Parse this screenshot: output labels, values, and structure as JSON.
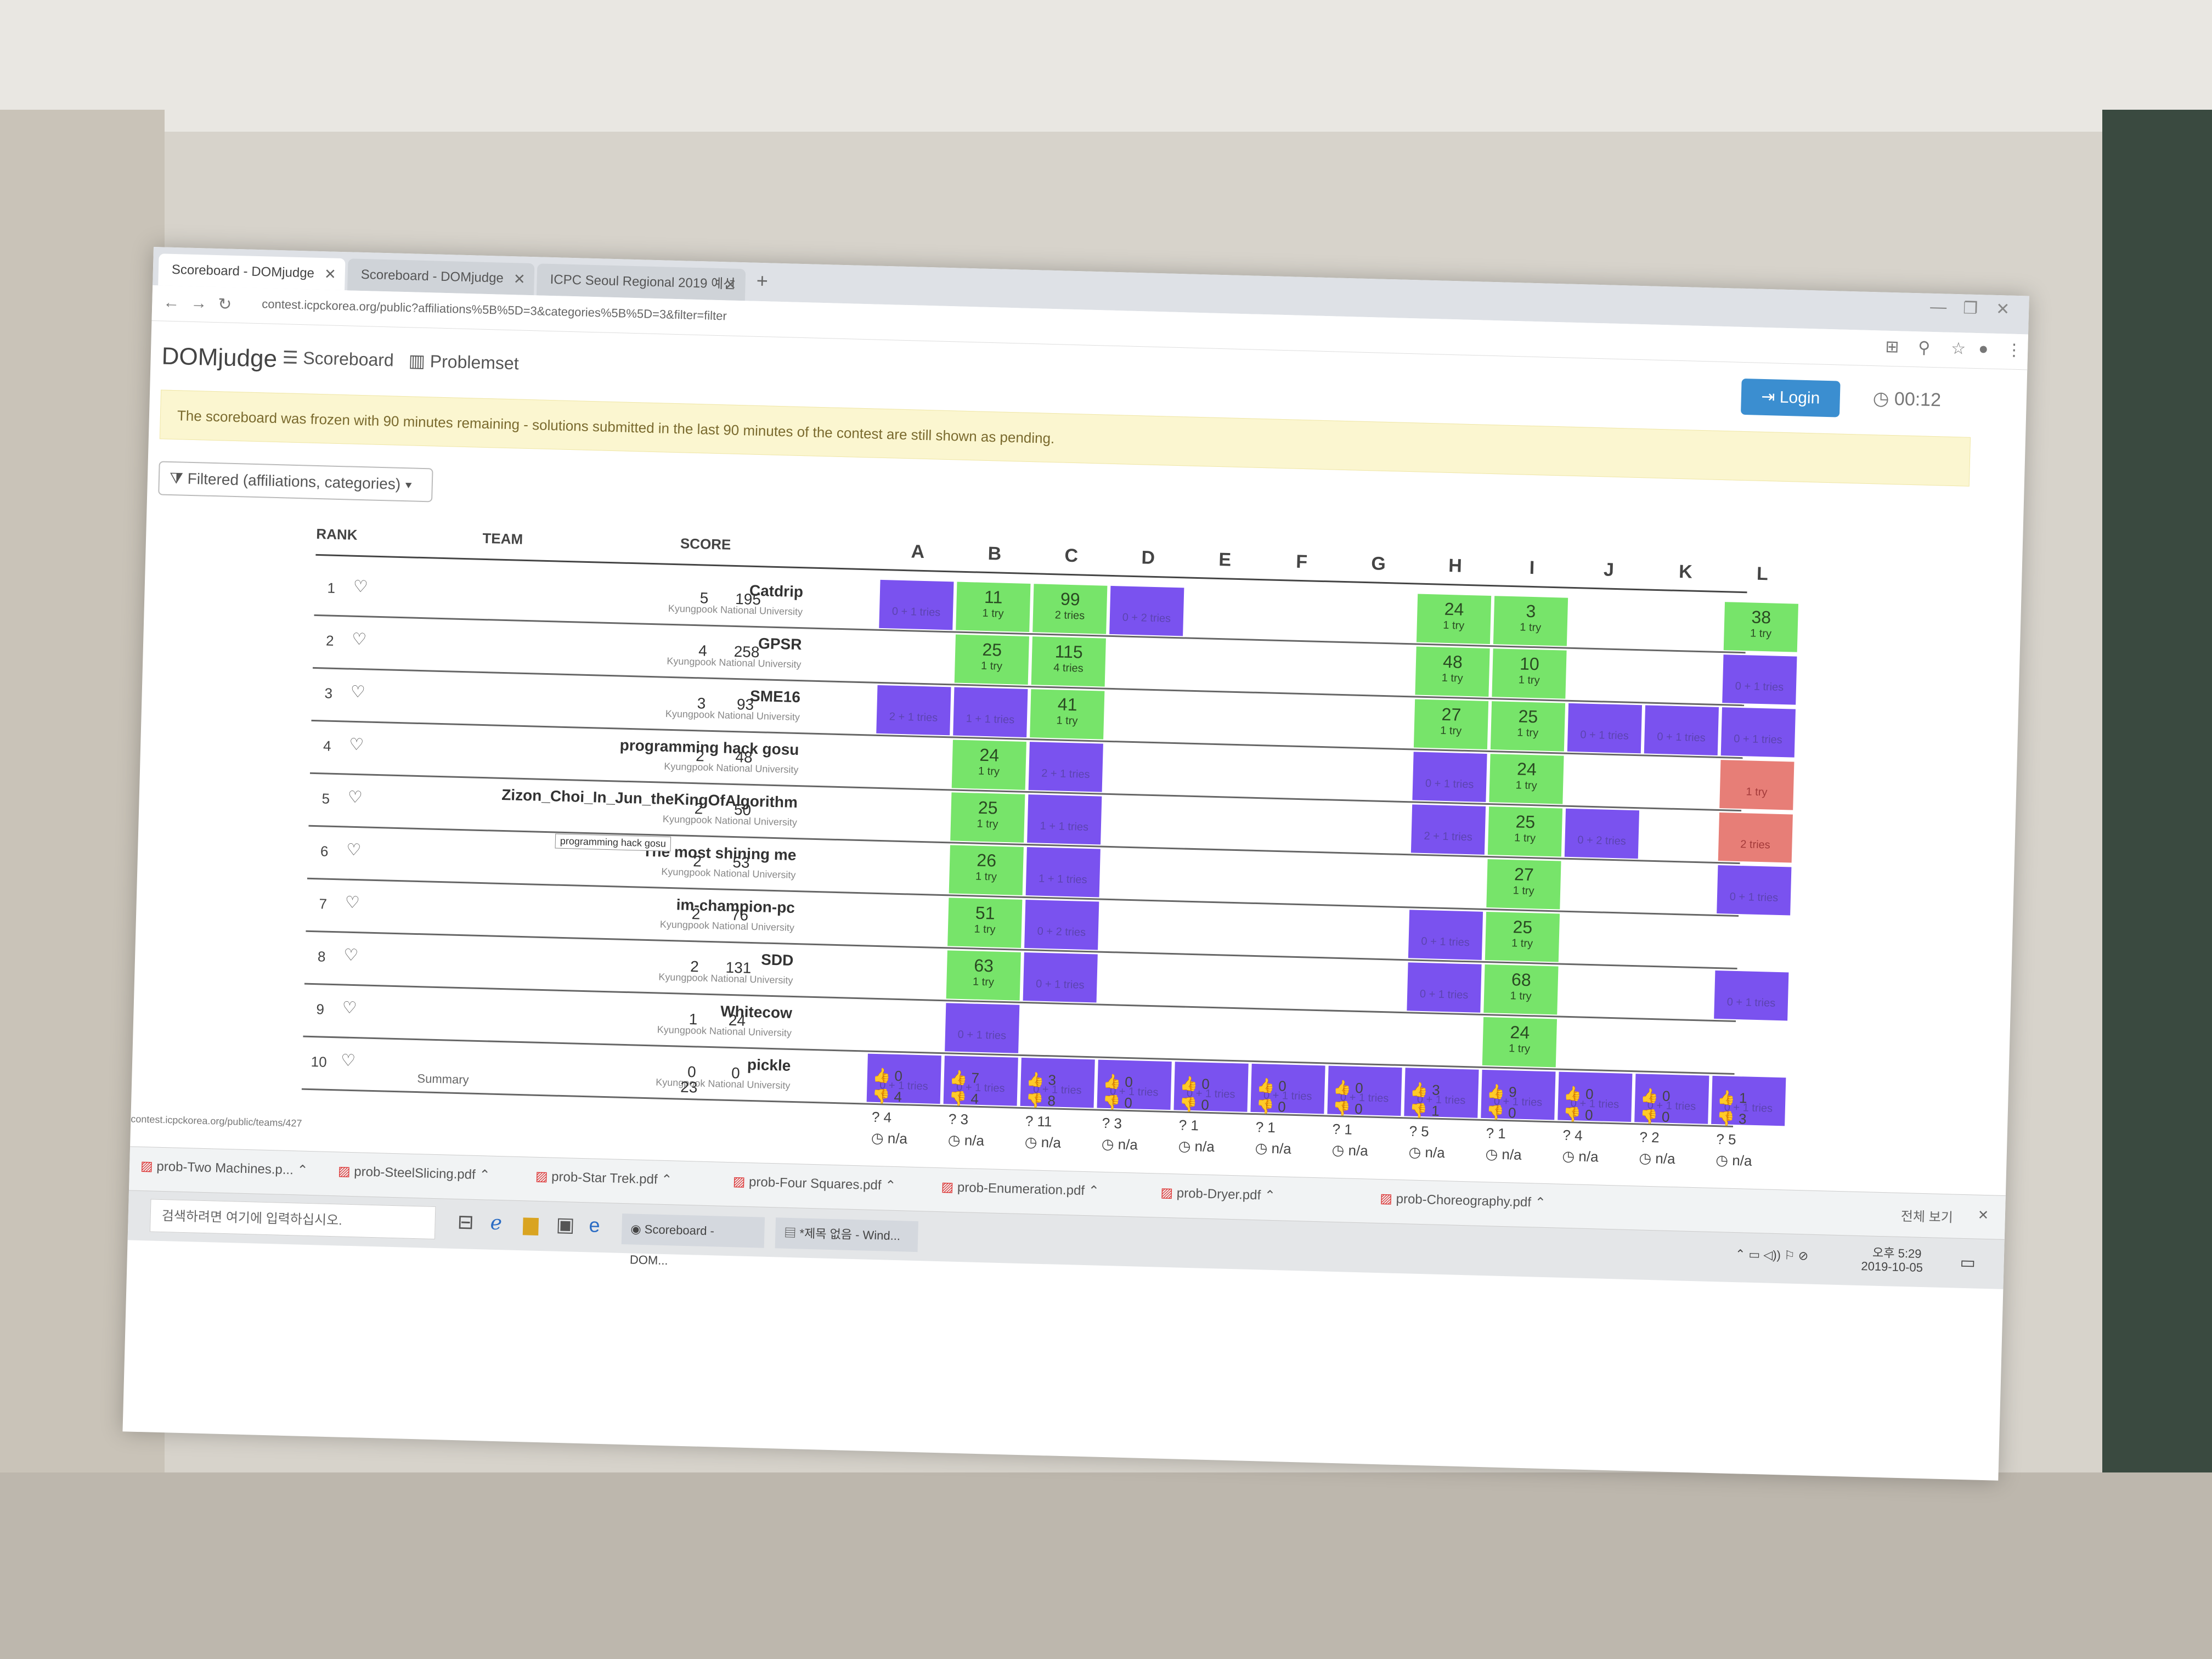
{
  "browser": {
    "tabs": [
      {
        "label": "Scoreboard - DOMjudge"
      },
      {
        "label": "Scoreboard - DOMjudge"
      },
      {
        "label": "ICPC Seoul Regional 2019 예선"
      }
    ],
    "url": "contest.icpckorea.org/public?affiliations%5B%5D=3&categories%5B%5D=3&filter=filter",
    "status_url": "contest.icpckorea.org/public/teams/427"
  },
  "nav": {
    "brand": "DOMjudge",
    "scoreboard": "Scoreboard",
    "problemset": "Problemset",
    "login": "Login",
    "clock": "00:12"
  },
  "notice": "The scoreboard was frozen with 90 minutes remaining - solutions submitted in the last 90 minutes of the contest are still shown as pending.",
  "filter_label": "Filtered (affiliations, categories)",
  "headers": {
    "rank": "RANK",
    "team": "TEAM",
    "score": "SCORE"
  },
  "problems": [
    "A",
    "B",
    "C",
    "D",
    "E",
    "F",
    "G",
    "H",
    "I",
    "J",
    "K",
    "L"
  ],
  "teams": [
    {
      "rank": "1",
      "name": "Catdrip",
      "aff": "Kyungpook National University",
      "solved": "5",
      "points": "195"
    },
    {
      "rank": "2",
      "name": "GPSR",
      "aff": "Kyungpook National University",
      "solved": "4",
      "points": "258"
    },
    {
      "rank": "3",
      "name": "SME16",
      "aff": "Kyungpook National University",
      "solved": "3",
      "points": "93"
    },
    {
      "rank": "4",
      "name": "programming hack gosu",
      "aff": "Kyungpook National University",
      "solved": "2",
      "points": "48"
    },
    {
      "rank": "5",
      "name": "Zizon_Choi_In_Jun_theKingOfAlgorithm",
      "aff": "Kyungpook National University",
      "solved": "2",
      "points": "50"
    },
    {
      "rank": "6",
      "name": "The most shining me",
      "aff": "Kyungpook National University",
      "solved": "2",
      "points": "53"
    },
    {
      "rank": "7",
      "name": "im-champion-pc",
      "aff": "Kyungpook National University",
      "solved": "2",
      "points": "76"
    },
    {
      "rank": "8",
      "name": "SDD",
      "aff": "Kyungpook National University",
      "solved": "2",
      "points": "131"
    },
    {
      "rank": "9",
      "name": "Whitecow",
      "aff": "Kyungpook National University",
      "solved": "1",
      "points": "24"
    },
    {
      "rank": "10",
      "name": "pickle",
      "aff": "Kyungpook National University",
      "solved": "0",
      "points": "0"
    }
  ],
  "cells": {
    "r0": {
      "A": {
        "status": "pending",
        "tries": "0 + 1 tries"
      },
      "B": {
        "status": "solved",
        "time": "11",
        "tries": "1 try"
      },
      "C": {
        "status": "solved",
        "time": "99",
        "tries": "2 tries"
      },
      "D": {
        "status": "pending",
        "tries": "0 + 2 tries"
      },
      "H": {
        "status": "solved",
        "time": "24",
        "tries": "1 try"
      },
      "I": {
        "status": "solved",
        "time": "3",
        "tries": "1 try"
      },
      "L": {
        "status": "solved",
        "time": "38",
        "tries": "1 try"
      }
    },
    "r1": {
      "B": {
        "status": "solved",
        "time": "25",
        "tries": "1 try"
      },
      "C": {
        "status": "solved",
        "time": "115",
        "tries": "4 tries"
      },
      "H": {
        "status": "solved",
        "time": "48",
        "tries": "1 try"
      },
      "I": {
        "status": "solved",
        "time": "10",
        "tries": "1 try"
      },
      "L": {
        "status": "pending",
        "tries": "0 + 1 tries"
      }
    },
    "r2": {
      "A": {
        "status": "pending",
        "tries": "2 + 1 tries"
      },
      "B": {
        "status": "pending",
        "tries": "1 + 1 tries"
      },
      "C": {
        "status": "solved",
        "time": "41",
        "tries": "1 try"
      },
      "H": {
        "status": "solved",
        "time": "27",
        "tries": "1 try"
      },
      "I": {
        "status": "solved",
        "time": "25",
        "tries": "1 try"
      },
      "J": {
        "status": "pending",
        "tries": "0 + 1 tries"
      },
      "K": {
        "status": "pending",
        "tries": "0 + 1 tries"
      },
      "L": {
        "status": "pending",
        "tries": "0 + 1 tries"
      }
    },
    "r3": {
      "B": {
        "status": "solved",
        "time": "24",
        "tries": "1 try"
      },
      "C": {
        "status": "pending",
        "tries": "2 + 1 tries"
      },
      "H": {
        "status": "pending",
        "tries": "0 + 1 tries"
      },
      "I": {
        "status": "solved",
        "time": "24",
        "tries": "1 try"
      },
      "L": {
        "status": "wrong",
        "tries": "1 try"
      }
    },
    "r4": {
      "B": {
        "status": "solved",
        "time": "25",
        "tries": "1 try"
      },
      "C": {
        "status": "pending",
        "tries": "1 + 1 tries"
      },
      "H": {
        "status": "pending",
        "tries": "2 + 1 tries"
      },
      "I": {
        "status": "solved",
        "time": "25",
        "tries": "1 try"
      },
      "J": {
        "status": "pending",
        "tries": "0 + 2 tries"
      },
      "L": {
        "status": "wrong",
        "tries": "2 tries"
      }
    },
    "r5": {
      "B": {
        "status": "solved",
        "time": "26",
        "tries": "1 try"
      },
      "C": {
        "status": "pending",
        "tries": "1 + 1 tries"
      },
      "I": {
        "status": "solved",
        "time": "27",
        "tries": "1 try"
      },
      "L": {
        "status": "pending",
        "tries": "0 + 1 tries"
      }
    },
    "r6": {
      "B": {
        "status": "solved",
        "time": "51",
        "tries": "1 try"
      },
      "C": {
        "status": "pending",
        "tries": "0 + 2 tries"
      },
      "H": {
        "status": "pending",
        "tries": "0 + 1 tries"
      },
      "I": {
        "status": "solved",
        "time": "25",
        "tries": "1 try"
      }
    },
    "r7": {
      "B": {
        "status": "solved",
        "time": "63",
        "tries": "1 try"
      },
      "C": {
        "status": "pending",
        "tries": "0 + 1 tries"
      },
      "H": {
        "status": "pending",
        "tries": "0 + 1 tries"
      },
      "I": {
        "status": "solved",
        "time": "68",
        "tries": "1 try"
      },
      "L": {
        "status": "pending",
        "tries": "0 + 1 tries"
      }
    },
    "r8": {
      "B": {
        "status": "pending",
        "tries": "0 + 1 tries"
      },
      "I": {
        "status": "solved",
        "time": "24",
        "tries": "1 try"
      }
    },
    "r9": {
      "A": {
        "status": "pending",
        "tries": "0 + 1 tries"
      },
      "B": {
        "status": "pending",
        "tries": "0 + 1 tries"
      },
      "C": {
        "status": "pending",
        "tries": "0 + 1 tries"
      },
      "D": {
        "status": "pending",
        "tries": "0 + 1 tries"
      },
      "E": {
        "status": "pending",
        "tries": "0 + 1 tries"
      },
      "F": {
        "status": "pending",
        "tries": "0 + 1 tries"
      },
      "G": {
        "status": "pending",
        "tries": "0 + 1 tries"
      },
      "H": {
        "status": "pending",
        "tries": "0 + 1 tries"
      },
      "I": {
        "status": "pending",
        "tries": "0 + 1 tries"
      },
      "J": {
        "status": "pending",
        "tries": "0 + 1 tries"
      },
      "K": {
        "status": "pending",
        "tries": "0 + 1 tries"
      },
      "L": {
        "status": "pending",
        "tries": "0 + 1 tries"
      }
    }
  },
  "tooltip": "programming hack gosu",
  "summary": {
    "label": "Summary",
    "total": "23",
    "per_problem": [
      {
        "correct": "0",
        "wrong": "4",
        "pending": "4",
        "first": "n/a"
      },
      {
        "correct": "7",
        "wrong": "4",
        "pending": "3",
        "first": "n/a"
      },
      {
        "correct": "3",
        "wrong": "8",
        "pending": "11",
        "first": "n/a"
      },
      {
        "correct": "0",
        "wrong": "0",
        "pending": "3",
        "first": "n/a"
      },
      {
        "correct": "0",
        "wrong": "0",
        "pending": "1",
        "first": "n/a"
      },
      {
        "correct": "0",
        "wrong": "0",
        "pending": "1",
        "first": "n/a"
      },
      {
        "correct": "0",
        "wrong": "0",
        "pending": "1",
        "first": "n/a"
      },
      {
        "correct": "3",
        "wrong": "1",
        "pending": "5",
        "first": "n/a"
      },
      {
        "correct": "9",
        "wrong": "0",
        "pending": "1",
        "first": "n/a"
      },
      {
        "correct": "0",
        "wrong": "0",
        "pending": "4",
        "first": "n/a"
      },
      {
        "correct": "0",
        "wrong": "0",
        "pending": "2",
        "first": "n/a"
      },
      {
        "correct": "1",
        "wrong": "3",
        "pending": "5",
        "first": "n/a"
      }
    ]
  },
  "downloads": [
    {
      "label": "prob-Two Machines.p..."
    },
    {
      "label": "prob-SteelSlicing.pdf"
    },
    {
      "label": "prob-Star Trek.pdf"
    },
    {
      "label": "prob-Four Squares.pdf"
    },
    {
      "label": "prob-Enumeration.pdf"
    },
    {
      "label": "prob-Dryer.pdf"
    },
    {
      "label": "prob-Choreography.pdf"
    }
  ],
  "downloads_show_all": "전체 보기",
  "taskbar": {
    "search": "검색하려면 여기에 입력하십시오.",
    "app1": "Scoreboard - DOM...",
    "app2": "*제목 없음 - Wind...",
    "time": "오후 5:29",
    "date": "2019-10-05"
  },
  "colors": {
    "solved": "#77e46a",
    "pending": "#7a52ef",
    "wrong": "#e77e77",
    "login": "#3b8ed0",
    "notice": "#fbf6d0"
  }
}
